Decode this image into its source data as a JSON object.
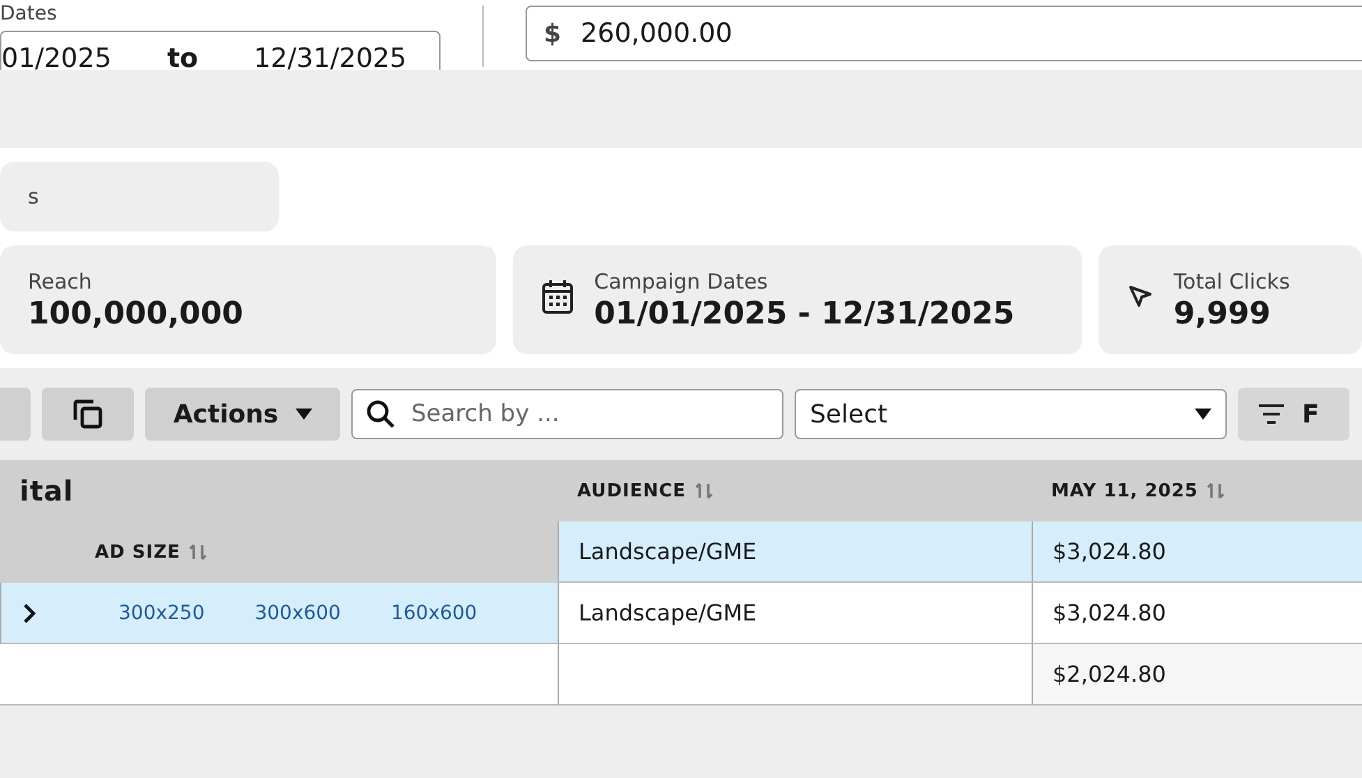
{
  "campaign_form": {
    "date_field": {
      "label": "Dates",
      "start": "01/2025",
      "separator": "to",
      "end": "12/31/2025"
    },
    "budget_field": {
      "currency": "$",
      "value": "260,000.00"
    }
  },
  "stat_rows": [
    [
      {
        "kind": "plain",
        "label": "s"
      }
    ],
    [
      {
        "kind": "plain",
        "label": "Reach",
        "value": "100,000,000"
      },
      {
        "kind": "dates",
        "label": "Campaign Dates",
        "value": "01/01/2025 - 12/31/2025"
      },
      {
        "kind": "clicks",
        "label": "Total Clicks",
        "value": "9,999"
      }
    ]
  ],
  "toolbar": {
    "buttons": [
      {
        "kind": "blank"
      },
      {
        "kind": "copy"
      },
      {
        "kind": "menu",
        "label": "Actions"
      }
    ],
    "search": {
      "placeholder": "Search by ..."
    },
    "select": {
      "value": "Select"
    },
    "filter_button": {
      "label": "F"
    }
  },
  "table": {
    "group_title": "ital",
    "columns": [
      {
        "label": "AUDIENCE",
        "sortable": true
      },
      {
        "label": "MAY 11, 2025",
        "sortable": true
      }
    ],
    "subheader": {
      "label": "AD SIZE",
      "sortable": true
    },
    "rows": [
      {
        "audience": "Landscape/GME",
        "amount": "$3,024.80",
        "selected": true
      },
      {
        "expanded": false,
        "ad_sizes": [
          "300x250",
          "300x600",
          "160x600"
        ],
        "audience": "Landscape/GME",
        "amount": "$3,024.80",
        "selected": false
      },
      {
        "amount": "$2,024.80",
        "selected": false
      }
    ]
  }
}
